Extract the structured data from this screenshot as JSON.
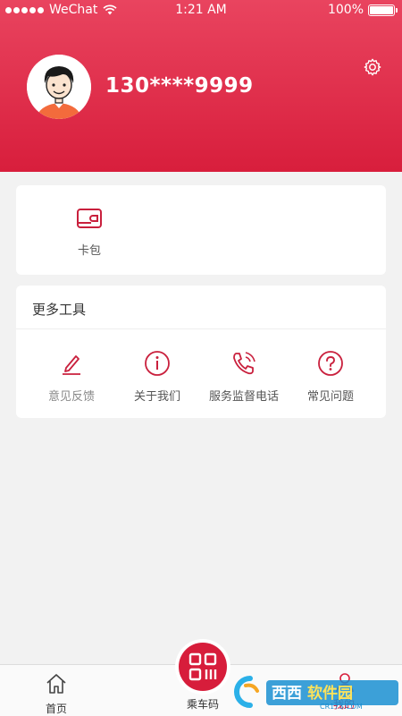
{
  "status_bar": {
    "carrier": "WeChat",
    "time": "1:21 AM",
    "battery": "100%"
  },
  "profile": {
    "phone": "130****9999"
  },
  "colors": {
    "brand": "#d81e3c",
    "brand_light": "#e9445f",
    "background": "#f2f2f2"
  },
  "wallet": {
    "label": "卡包",
    "icon": "wallet-icon"
  },
  "tools": {
    "title": "更多工具",
    "items": [
      {
        "label": "意见反馈",
        "icon": "pencil-icon"
      },
      {
        "label": "关于我们",
        "icon": "info-icon"
      },
      {
        "label": "服务监督电话",
        "icon": "phone-icon"
      },
      {
        "label": "常见问题",
        "icon": "question-icon"
      }
    ]
  },
  "tabbar": {
    "home": "首页",
    "qr": "乘车码",
    "mine": "我的"
  },
  "watermark": {
    "brand": "西西软件园",
    "domain": "CR173.COM"
  }
}
